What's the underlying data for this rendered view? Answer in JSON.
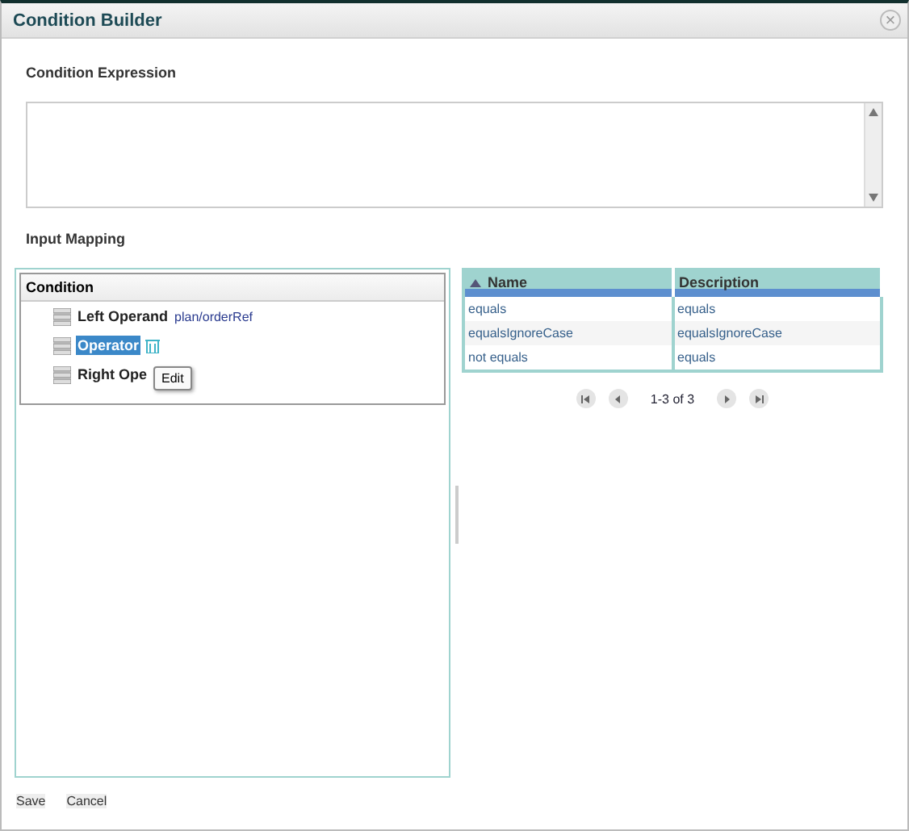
{
  "window": {
    "title": "Condition Builder",
    "close": "×"
  },
  "expression": {
    "label": "Condition Expression"
  },
  "input_mapping": {
    "label": "Input Mapping"
  },
  "tree": {
    "heading": "Condition",
    "items": [
      {
        "label": "Left Operand",
        "value": "plan/orderRef",
        "selected": false
      },
      {
        "label": "Operator",
        "selected": true
      },
      {
        "label": "Right Ope",
        "selected": false
      }
    ],
    "tooltip": "Edit"
  },
  "table": {
    "columns": [
      {
        "label": "Name",
        "sorted": true
      },
      {
        "label": "Description",
        "sorted": false
      }
    ],
    "rows": [
      [
        "equals",
        "equals"
      ],
      [
        "equalsIgnoreCase",
        "equalsIgnoreCase"
      ],
      [
        "not equals",
        "equals"
      ]
    ]
  },
  "pager": {
    "text": "1-3 of 3"
  },
  "buttons": [
    "Save",
    "Cancel"
  ]
}
